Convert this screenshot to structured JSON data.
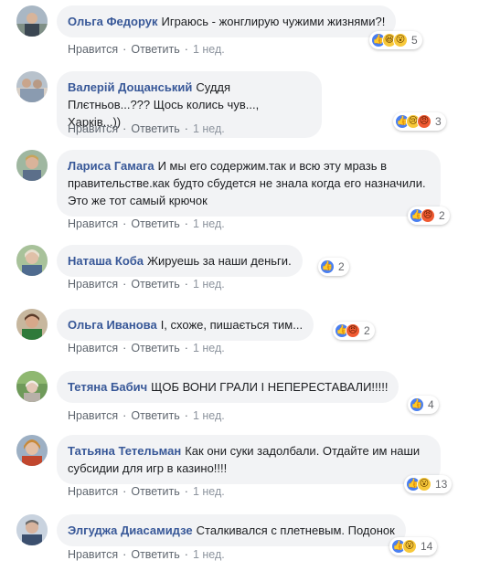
{
  "labels": {
    "like": "Нравится",
    "reply": "Ответить",
    "separator": "·"
  },
  "comments": [
    {
      "author": "Ольга Федорук",
      "text": "Играюсь - жонглирую чужими жизнями?!",
      "time": "1 нед.",
      "reactions": [
        "like-icon",
        "haha-icon",
        "wow-icon"
      ],
      "reaction_count": "5"
    },
    {
      "author": "Валерій Дощанський",
      "text": "Суддя Плєтньов...??? Щось колись чув..., Харків...))",
      "time": "1 нед.",
      "reactions": [
        "like-icon",
        "sad-icon",
        "angry-icon"
      ],
      "reaction_count": "3"
    },
    {
      "author": "Лариса Гамага",
      "text": "И мы его содержим.так и всю эту мразь в правительстве.как будто сбудется не знала когда его назначили. Это же тот самый крючок",
      "time": "1 нед.",
      "reactions": [
        "angry-icon"
      ],
      "reaction_count": "2"
    },
    {
      "author": "Наташа Коба",
      "text": "Жируешь за наши деньги.",
      "time": "1 нед.",
      "reactions": [
        "like-icon"
      ],
      "reaction_count": "2"
    },
    {
      "author": "Ольга Иванова",
      "text": "І, схоже, пишається тим...",
      "time": "1 нед.",
      "reactions": [
        "like-icon",
        "angry-icon"
      ],
      "reaction_count": "2"
    },
    {
      "author": "Тетяна Бабич",
      "text": "ЩОБ ВОНИ ГРАЛИ І НЕПЕРЕСТАВАЛИ!!!!!",
      "time": "1 нед.",
      "reactions": [
        "like-icon"
      ],
      "reaction_count": "4"
    },
    {
      "author": "Татьяна Тетельман",
      "text": "Как они суки задолбали. Отдайте им наши субсидии для игр в казино!!!!",
      "time": "1 нед.",
      "reactions": [
        "like-icon",
        "wow-icon"
      ],
      "reaction_count": "13"
    },
    {
      "author": "Элгуджа Диасамидзе",
      "text": "Сталкивался с плетневым. Подонок",
      "time": "1 нед.",
      "reactions": [
        "like-icon",
        "wow-icon"
      ],
      "reaction_count": "14"
    }
  ]
}
